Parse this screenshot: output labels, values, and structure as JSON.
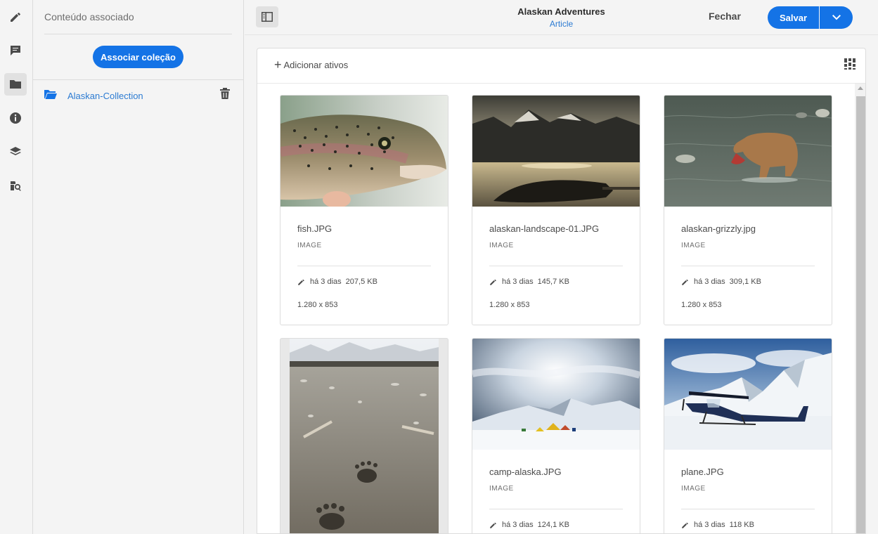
{
  "panel": {
    "title": "Conteúdo associado",
    "associate_button": "Associar coleção",
    "collection": {
      "label": "Alaskan-Collection"
    }
  },
  "rail": {
    "icons": [
      "edit-icon",
      "comments-icon",
      "folder-icon",
      "info-icon",
      "layers-icon",
      "asset-search-icon"
    ],
    "active": "folder-icon"
  },
  "header": {
    "title": "Alaskan Adventures",
    "subtitle": "Article",
    "close_label": "Fechar",
    "save_label": "Salvar"
  },
  "content": {
    "add_assets_label": "Adicionar ativos"
  },
  "assets": [
    {
      "name": "fish.JPG",
      "type": "IMAGE",
      "modified": "há 3 dias",
      "size": "207,5 KB",
      "dimensions": "1.280 x 853"
    },
    {
      "name": "alaskan-landscape-01.JPG",
      "type": "IMAGE",
      "modified": "há 3 dias",
      "size": "145,7 KB",
      "dimensions": "1.280 x 853"
    },
    {
      "name": "alaskan-grizzly.jpg",
      "type": "IMAGE",
      "modified": "há 3 dias",
      "size": "309,1 KB",
      "dimensions": "1.280 x 853"
    },
    {
      "name": "camp-alaska.JPG",
      "type": "IMAGE",
      "modified": "há 3 dias",
      "size": "124,1 KB"
    },
    {
      "name": "plane.JPG",
      "type": "IMAGE",
      "modified": "há 3 dias",
      "size": "118 KB"
    }
  ],
  "colors": {
    "accent": "#1473e6",
    "link": "#2c7bd2"
  }
}
